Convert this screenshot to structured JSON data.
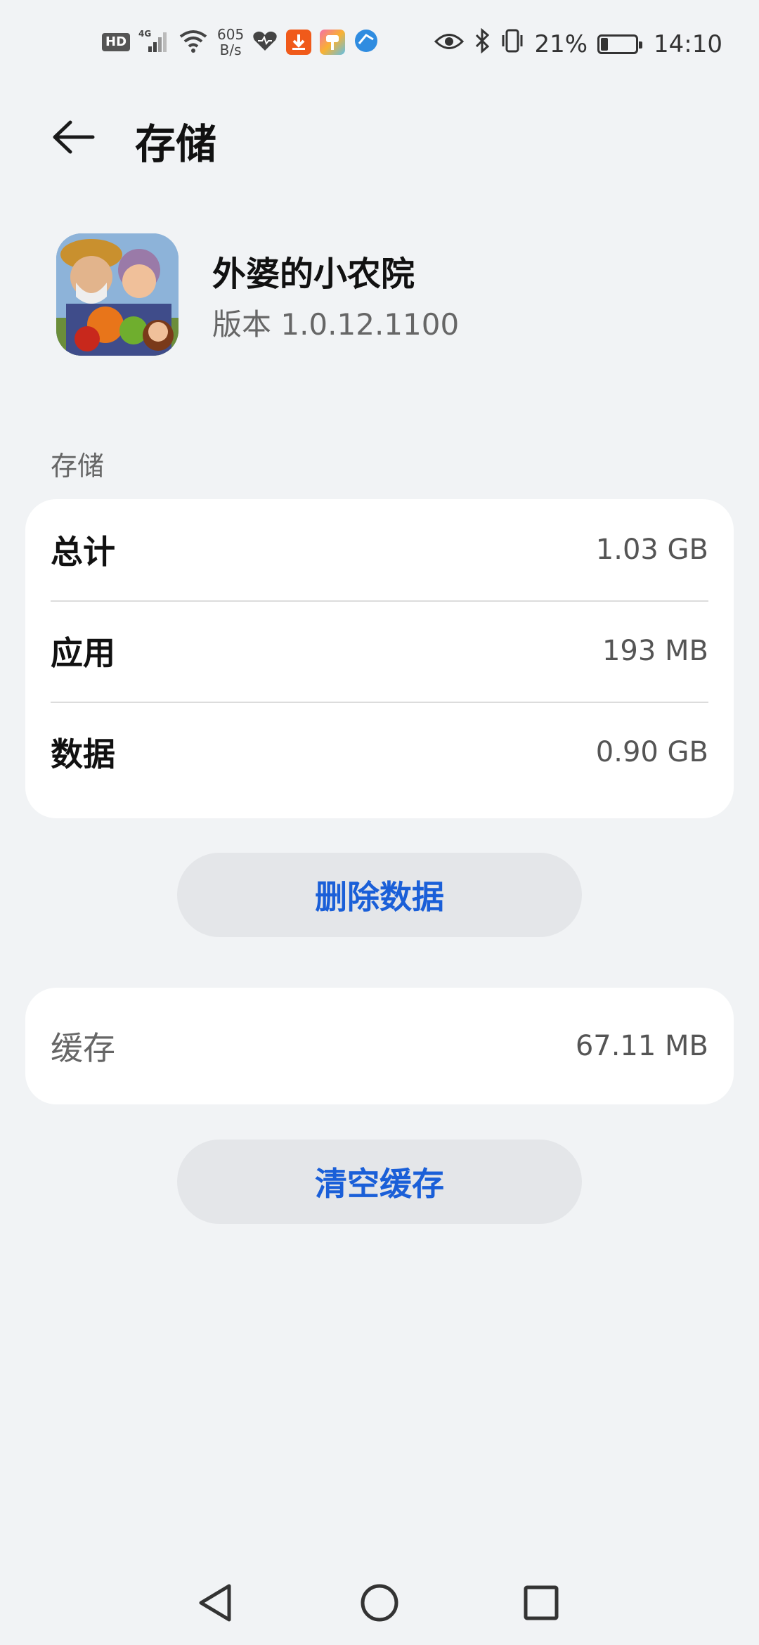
{
  "status_bar": {
    "hd": "HD",
    "network": "4G",
    "net_speed_value": "605",
    "net_speed_unit": "B/s",
    "battery_percent": "21%",
    "battery_level": 0.21,
    "time": "14:10"
  },
  "header": {
    "title": "存储"
  },
  "app": {
    "name": "外婆的小农院",
    "version": "版本 1.0.12.1100"
  },
  "storage": {
    "section_label": "存储",
    "rows": [
      {
        "label": "总计",
        "value": "1.03 GB"
      },
      {
        "label": "应用",
        "value": "193 MB"
      },
      {
        "label": "数据",
        "value": "0.90 GB"
      }
    ],
    "delete_label": "删除数据"
  },
  "cache": {
    "label": "缓存",
    "value": "67.11 MB",
    "clear_label": "清空缓存"
  },
  "colors": {
    "accent": "#1a5fd8",
    "background": "#f1f3f5"
  }
}
